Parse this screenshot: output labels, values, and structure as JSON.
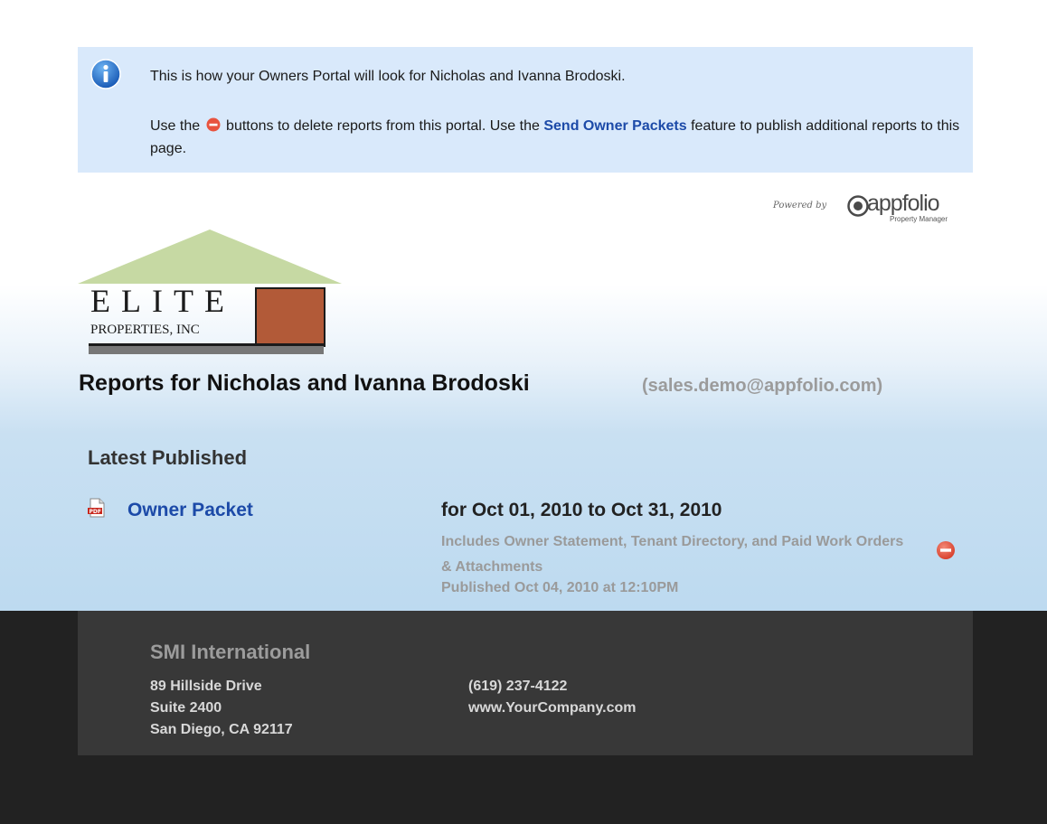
{
  "notice": {
    "line1": "This is how your Owners Portal will look for Nicholas and Ivanna Brodoski.",
    "line2_prefix": "Use the",
    "line2_middle": "buttons to delete reports from this portal. Use the",
    "line2_link": "Send Owner Packets",
    "line2_suffix": "feature to publish additional reports to this page.",
    "icon": "info-icon"
  },
  "powered_by": {
    "prefix": "Powered by",
    "brand": "appfolio",
    "sub": "Property Manager"
  },
  "logo": {
    "word": "ELITE",
    "subtitle": "PROPERTIES, INC",
    "roof_color": "#c6d9a3",
    "box_color": "#b25a38"
  },
  "page": {
    "title": "Reports for Nicholas and Ivanna Brodoski",
    "email": "(sales.demo@appfolio.com)"
  },
  "latest": {
    "heading": "Latest Published",
    "report": {
      "name": "Owner Packet",
      "period": "for Oct 01, 2010 to Oct 31, 2010",
      "description": "Includes Owner Statement, Tenant Directory, and Paid Work Orders & Attachments",
      "published": "Published Oct 04, 2010 at 12:10PM",
      "icon": "pdf-icon"
    }
  },
  "footer": {
    "company": "SMI International",
    "address": [
      "89 Hillside Drive",
      "Suite 2400",
      "San Diego, CA 92117"
    ],
    "contact": [
      "(619) 237-4122",
      "www.YourCompany.com"
    ]
  },
  "colors": {
    "link": "#1c4aa8",
    "notice_bg": "#d9e9fb",
    "footer_bg": "#222222",
    "footer_panel": "#383838",
    "delete_red": "#e8533f"
  }
}
